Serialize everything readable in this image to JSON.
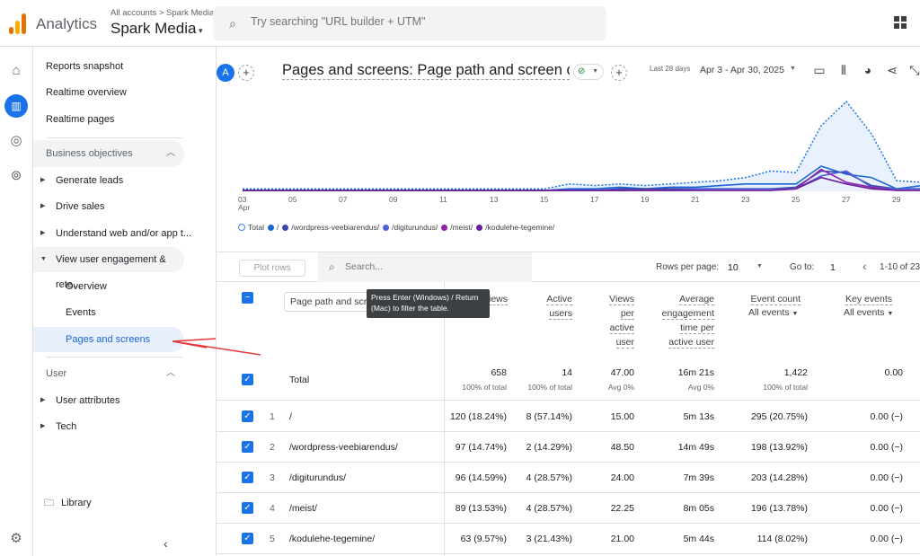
{
  "topbar": {
    "app_name": "Analytics",
    "breadcrumb": "All accounts > Spark Media",
    "account": "Spark Media",
    "search_placeholder": "Try searching \"URL builder + UTM\""
  },
  "nav": {
    "reports_snapshot": "Reports snapshot",
    "realtime_overview": "Realtime overview",
    "realtime_pages": "Realtime pages",
    "business_objectives": "Business objectives",
    "generate_leads": "Generate leads",
    "drive_sales": "Drive sales",
    "understand": "Understand web and/or app t...",
    "view_engagement": "View user engagement & rete...",
    "overview": "Overview",
    "events": "Events",
    "pages_and_screens": "Pages and screens",
    "user": "User",
    "user_attributes": "User attributes",
    "tech": "Tech",
    "library": "Library"
  },
  "header": {
    "avatar": "A",
    "title": "Pages and screens: Page path and screen class",
    "date_chip": "Last 28 days",
    "date_range": "Apr 3 - Apr 30, 2025"
  },
  "chart_data": {
    "type": "line",
    "x": [
      "03 Apr",
      "04",
      "05",
      "06",
      "07",
      "08",
      "09",
      "10",
      "11",
      "12",
      "13",
      "14",
      "15",
      "16",
      "17",
      "18",
      "19",
      "20",
      "21",
      "22",
      "23",
      "24",
      "25",
      "26",
      "27",
      "28",
      "29",
      "30"
    ],
    "x_ticks": [
      "03",
      "05",
      "07",
      "09",
      "11",
      "13",
      "15",
      "17",
      "19",
      "21",
      "23",
      "25",
      "27",
      "29"
    ],
    "x_tick_sub": "Apr",
    "series": [
      {
        "name": "Total",
        "color": "#1a73e8",
        "style": "dotted-area",
        "values": [
          1,
          1,
          1,
          1,
          1,
          1,
          1,
          1,
          1,
          1,
          1,
          1,
          1,
          4,
          3,
          4,
          3,
          4,
          5,
          6,
          8,
          12,
          11,
          40,
          55,
          35,
          6,
          5
        ]
      },
      {
        "name": "/",
        "color": "#1967d2",
        "values": [
          0,
          0,
          0,
          0,
          0,
          0,
          0,
          0,
          0,
          0,
          0,
          0,
          0,
          1,
          1,
          2,
          1,
          2,
          2,
          3,
          4,
          4,
          4,
          15,
          10,
          8,
          1,
          3
        ]
      },
      {
        "name": "/wordpress-veebiarendus/",
        "color": "#3949ab",
        "values": [
          0,
          0,
          0,
          0,
          0,
          0,
          0,
          0,
          0,
          0,
          0,
          0,
          0,
          0,
          0,
          1,
          1,
          1,
          1,
          1,
          1,
          1,
          2,
          12,
          11,
          3,
          1,
          1
        ]
      },
      {
        "name": "/digiturundus/",
        "color": "#4a63d8",
        "values": [
          0,
          0,
          0,
          0,
          0,
          0,
          0,
          0,
          0,
          0,
          0,
          0,
          0,
          0,
          0,
          0,
          0,
          0,
          1,
          1,
          1,
          1,
          1,
          9,
          12,
          2,
          1,
          1
        ]
      },
      {
        "name": "/meist/",
        "color": "#8e24aa",
        "values": [
          0,
          0,
          0,
          0,
          0,
          0,
          0,
          0,
          0,
          0,
          0,
          0,
          0,
          0,
          0,
          0,
          0,
          0,
          0,
          0,
          0,
          0,
          1,
          13,
          5,
          2,
          0,
          0
        ]
      },
      {
        "name": "/kodulehe-tegemine/",
        "color": "#6a1b9a",
        "values": [
          0,
          0,
          0,
          0,
          0,
          0,
          0,
          0,
          0,
          0,
          0,
          0,
          0,
          0,
          0,
          0,
          0,
          0,
          0,
          0,
          0,
          0,
          1,
          8,
          4,
          1,
          0,
          0
        ]
      }
    ]
  },
  "table_controls": {
    "plot_rows": "Plot rows",
    "search_placeholder": "Search...",
    "rows_per_page_label": "Rows per page:",
    "rows_per_page": "10",
    "goto_label": "Go to:",
    "goto_value": "1",
    "pager": "1-10 of 23"
  },
  "table": {
    "dimension_label": "Page path and screen class",
    "tooltip": "Press Enter (Windows) / Return (Mac) to filter the table.",
    "col_views": "iews",
    "col_active": "Active users",
    "col_vpu": "Views per active user",
    "col_aet": "Average engagement time per active user",
    "col_events": "Event count",
    "col_events_sub": "All events",
    "col_key": "Key events",
    "col_key_sub": "All events",
    "total": {
      "label": "Total",
      "views": "658",
      "views_sub": "100% of total",
      "active": "14",
      "active_sub": "100% of total",
      "vpu": "47.00",
      "vpu_sub": "Avg 0%",
      "aet": "16m 21s",
      "aet_sub": "Avg 0%",
      "events": "1,422",
      "events_sub": "100% of total",
      "key": "0.00"
    },
    "rows": [
      {
        "n": "1",
        "path": "/",
        "views": "120 (18.24%)",
        "active": "8 (57.14%)",
        "vpu": "15.00",
        "aet": "5m 13s",
        "events": "295 (20.75%)",
        "key": "0.00 (−)"
      },
      {
        "n": "2",
        "path": "/wordpress-veebiarendus/",
        "views": "97 (14.74%)",
        "active": "2 (14.29%)",
        "vpu": "48.50",
        "aet": "14m 49s",
        "events": "198 (13.92%)",
        "key": "0.00 (−)"
      },
      {
        "n": "3",
        "path": "/digiturundus/",
        "views": "96 (14.59%)",
        "active": "4 (28.57%)",
        "vpu": "24.00",
        "aet": "7m 39s",
        "events": "203 (14.28%)",
        "key": "0.00 (−)"
      },
      {
        "n": "4",
        "path": "/meist/",
        "views": "89 (13.53%)",
        "active": "4 (28.57%)",
        "vpu": "22.25",
        "aet": "8m 05s",
        "events": "196 (13.78%)",
        "key": "0.00 (−)"
      },
      {
        "n": "5",
        "path": "/kodulehe-tegemine/",
        "views": "63 (9.57%)",
        "active": "3 (21.43%)",
        "vpu": "21.00",
        "aet": "5m 44s",
        "events": "114 (8.02%)",
        "key": "0.00 (−)"
      }
    ]
  },
  "colors": {
    "accent": "#1a73e8",
    "annotation_arrow": "#e53935"
  }
}
